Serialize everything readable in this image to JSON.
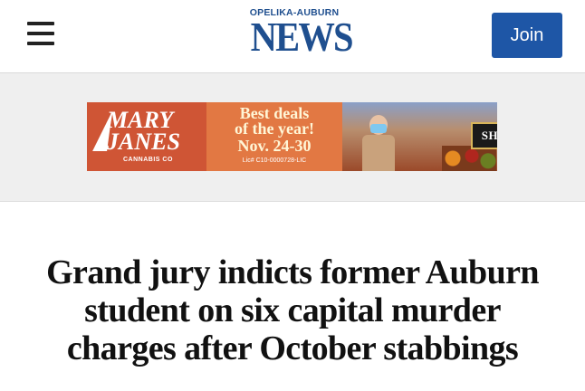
{
  "header": {
    "logo_top": "OPELIKA-AUBURN",
    "logo_main": "NEWS",
    "join_label": "Join",
    "menu_icon": "hamburger-menu-icon",
    "brand_color": "#1f4f8f",
    "button_color": "#1e56a6"
  },
  "ad": {
    "brand_name": "MARY\nJANES",
    "brand_sub": "CANNABIS CO",
    "line1": "Best deals",
    "line2": "of the year!",
    "line3": "Nov. 24-30",
    "license": "Lic# C10-0000728-LIC",
    "cta": "SHOP NOW"
  },
  "article": {
    "headline": "Grand jury indicts former Auburn student on six capital murder charges after October stabbings"
  }
}
